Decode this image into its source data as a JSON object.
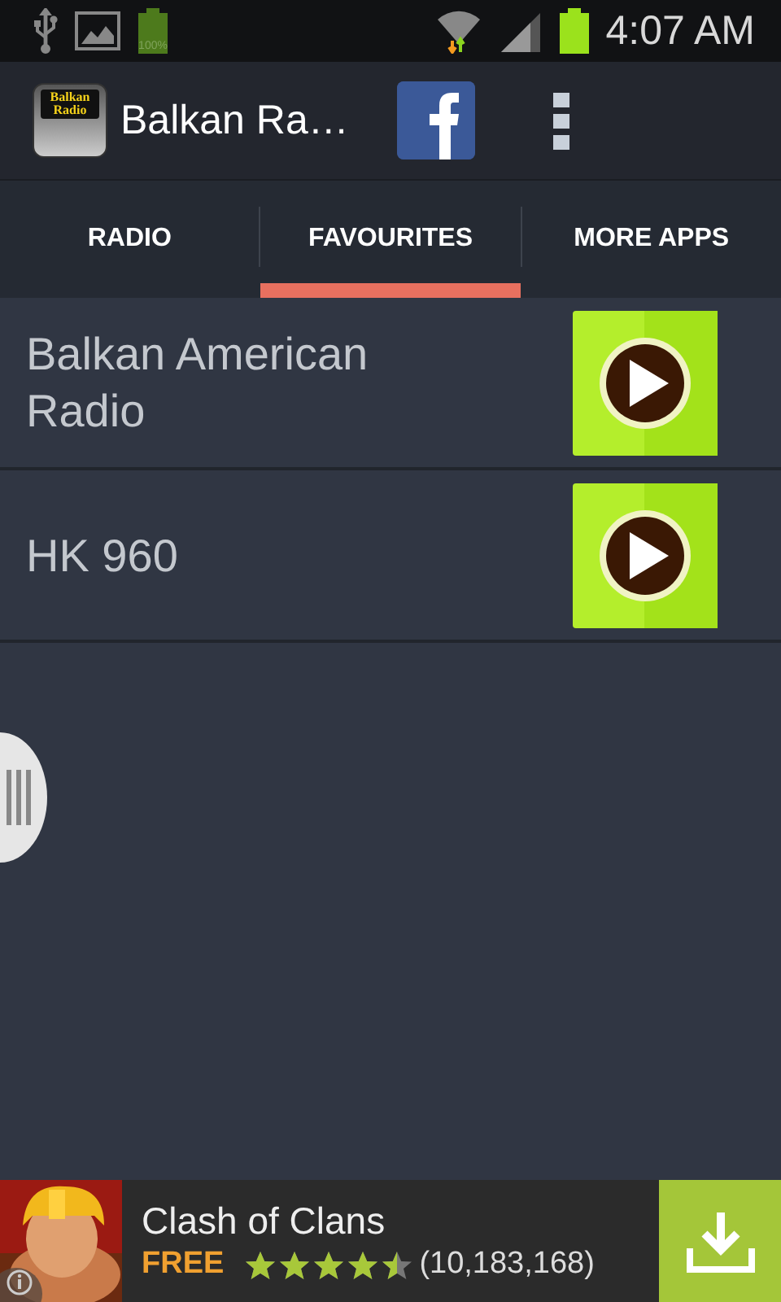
{
  "status_bar": {
    "battery_label": "100%",
    "time": "4:07 AM"
  },
  "action_bar": {
    "app_icon_text": "Balkan Radio",
    "title": "Balkan Ra…"
  },
  "tabs": [
    {
      "label": "RADIO",
      "selected": false
    },
    {
      "label": "FAVOURITES",
      "selected": true
    },
    {
      "label": "MORE APPS",
      "selected": false
    }
  ],
  "stations": [
    {
      "name": "Balkan American Radio"
    },
    {
      "name": "HK 960"
    }
  ],
  "ad": {
    "title": "Clash of Clans",
    "price": "FREE",
    "stars": 4.5,
    "rating_count": "(10,183,168)"
  }
}
